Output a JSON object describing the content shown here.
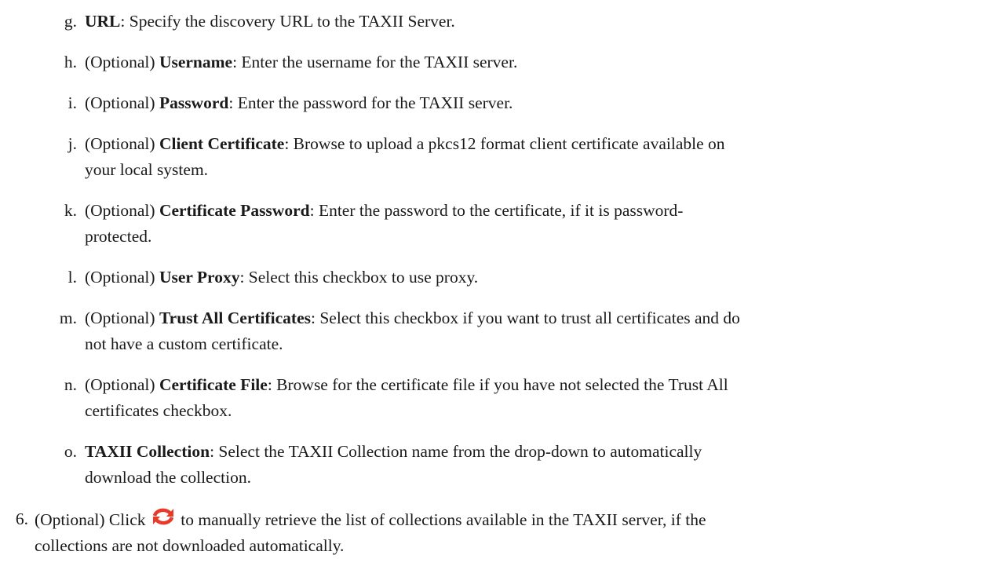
{
  "substeps": [
    {
      "marker": "g.",
      "optional": "",
      "term": "URL",
      "desc": ": Specify the discovery URL to the TAXII Server."
    },
    {
      "marker": "h.",
      "optional": "(Optional) ",
      "term": "Username",
      "desc": ": Enter the username for the TAXII server."
    },
    {
      "marker": "i.",
      "optional": "(Optional) ",
      "term": "Password",
      "desc": ": Enter the password for the TAXII server."
    },
    {
      "marker": "j.",
      "optional": "(Optional) ",
      "term": "Client Certificate",
      "desc": ": Browse to upload a pkcs12 format client certificate available on",
      "desc2": "your local system."
    },
    {
      "marker": "k.",
      "optional": "(Optional) ",
      "term": "Certificate Password",
      "desc": ": Enter the password to the certificate, if it is password-",
      "desc2": "protected."
    },
    {
      "marker": "l.",
      "optional": "(Optional) ",
      "term": "User Proxy",
      "desc": ": Select this checkbox to use proxy."
    },
    {
      "marker": "m.",
      "optional": "(Optional) ",
      "term": "Trust All Certificates",
      "desc": ": Select this checkbox if you want to trust all certificates and do",
      "desc2": "not have a custom certificate."
    },
    {
      "marker": "n.",
      "optional": "(Optional) ",
      "term": "Certificate File",
      "desc": ": Browse for the certificate file if you have not selected the Trust All",
      "desc2": "certificates checkbox."
    },
    {
      "marker": "o.",
      "optional": "",
      "term": "TAXII Collection",
      "desc": ": Select the TAXII Collection name from the drop-down to automatically",
      "desc2": "download the collection."
    }
  ],
  "step6": {
    "marker": "6.",
    "prefix": "(Optional) Click",
    "icon": "refresh-icon",
    "icon_color": "#e8392b",
    "suffix": "to manually retrieve the list of collections available in the TAXII server, if the",
    "line2": "collections are not downloaded automatically."
  }
}
